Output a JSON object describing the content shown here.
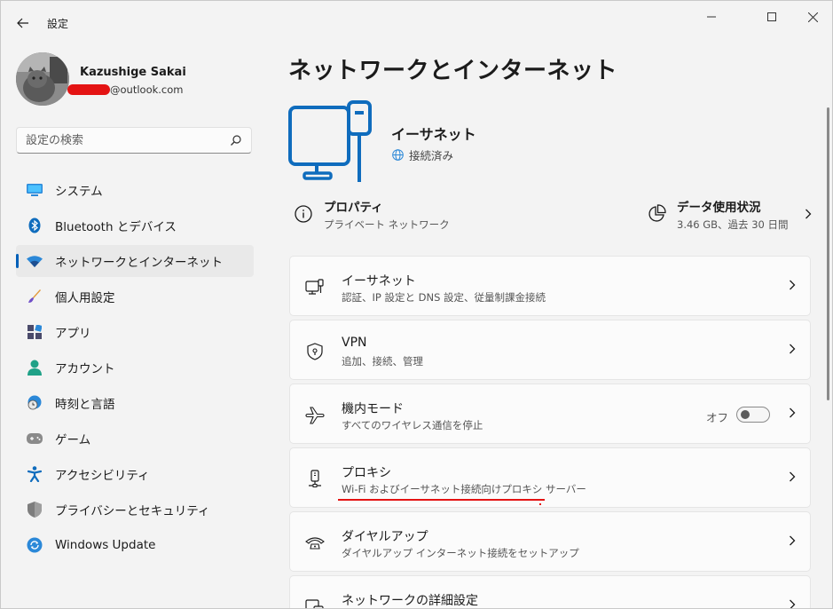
{
  "window": {
    "title": "設定"
  },
  "profile": {
    "name": "Kazushige Sakai",
    "email_suffix": "@outlook.com"
  },
  "search": {
    "placeholder": "設定の検索"
  },
  "nav": {
    "items": [
      {
        "label": "システム",
        "icon": "monitor-icon"
      },
      {
        "label": "Bluetooth とデバイス",
        "icon": "bluetooth-icon"
      },
      {
        "label": "ネットワークとインターネット",
        "icon": "wifi-icon",
        "selected": true
      },
      {
        "label": "個人用設定",
        "icon": "brush-icon"
      },
      {
        "label": "アプリ",
        "icon": "apps-icon"
      },
      {
        "label": "アカウント",
        "icon": "person-icon"
      },
      {
        "label": "時刻と言語",
        "icon": "clock-globe-icon"
      },
      {
        "label": "ゲーム",
        "icon": "gamepad-icon"
      },
      {
        "label": "アクセシビリティ",
        "icon": "accessibility-icon"
      },
      {
        "label": "プライバシーとセキュリティ",
        "icon": "shield-icon"
      },
      {
        "label": "Windows Update",
        "icon": "update-icon"
      }
    ]
  },
  "main": {
    "title": "ネットワークとインターネット",
    "connection": {
      "name": "イーサネット",
      "status": "接続済み"
    },
    "properties": {
      "title": "プロパティ",
      "subtitle": "プライベート ネットワーク"
    },
    "data_usage": {
      "title": "データ使用状況",
      "subtitle": "3.46 GB、過去 30 日間"
    },
    "cards": [
      {
        "title": "イーサネット",
        "subtitle": "認証、IP 設定と DNS 設定、従量制課金接続",
        "icon": "ethernet-pc-icon"
      },
      {
        "title": "VPN",
        "subtitle": "追加、接続、管理",
        "icon": "vpn-shield-icon"
      },
      {
        "title": "機内モード",
        "subtitle": "すべてのワイヤレス通信を停止",
        "icon": "airplane-icon",
        "toggle_label": "オフ",
        "toggle_on": false
      },
      {
        "title": "プロキシ",
        "subtitle": "Wi-Fi およびイーサネット接続向けプロキシ サーバー",
        "icon": "proxy-icon"
      },
      {
        "title": "ダイヤルアップ",
        "subtitle": "ダイヤルアップ インターネット接続をセットアップ",
        "icon": "dialup-icon"
      },
      {
        "title": "ネットワークの詳細設定",
        "subtitle": "",
        "icon": "network-advanced-icon"
      }
    ]
  },
  "colors": {
    "accent": "#005fb8",
    "annotation_red": "#e41313",
    "background": "#f3f3f3"
  }
}
